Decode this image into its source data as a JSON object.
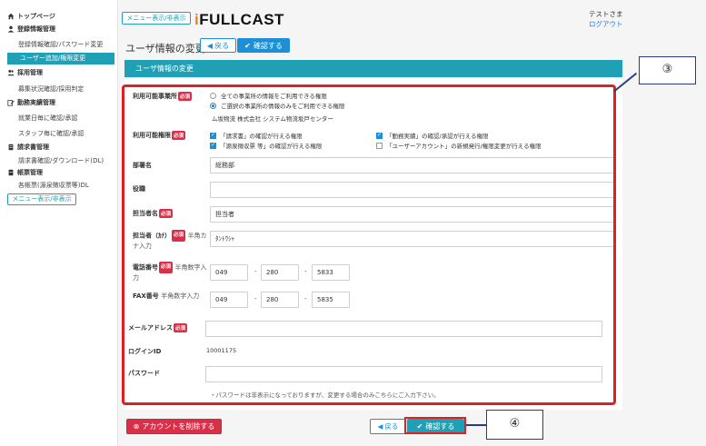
{
  "sidebar": {
    "top_page": "トップページ",
    "cat_registration": "登録情報管理",
    "item_password": "登録情報確認/パスワード変更",
    "item_user_add": "ユーザー追加/権限変更",
    "cat_recruit": "採用管理",
    "item_recruit_status": "募集状況確認/採用判定",
    "cat_attendance": "勤務実績管理",
    "item_daily": "就業日毎に確認/承認",
    "item_staff": "スタッフ毎に確認/承認",
    "cat_invoice": "請求書管理",
    "item_invoice_dl": "請求書確認/ダウンロード(DL)",
    "cat_forms": "帳票管理",
    "item_forms_dl": "各帳票(源泉徴収票等)DL",
    "menu_toggle": "メニュー表示/非表示"
  },
  "header": {
    "menu_toggle": "メニュー表示/非表示",
    "logo": "FULLCAST",
    "user_name": "テストさま",
    "logout": "ログアウト"
  },
  "page": {
    "title": "ユーザ情報の変更",
    "back": "戻る",
    "confirm": "確認する",
    "panel_title": "ユーザ情報の変更"
  },
  "form": {
    "required": "必須",
    "office_label": "利用可能事業所",
    "office_opt_all": "全ての事業所の情報をご利用できる権限",
    "office_opt_selected": "ご選択の事業所の情報のみをご利用できる権限",
    "office_name": "ム坂物流 株式会社 システム物流坂戸センター",
    "perm_label": "利用可能権限",
    "perm_invoice": "「請求書」の確認が行える権限",
    "perm_attendance": "「勤務実績」の確認/承認が行える権限",
    "perm_withholding": "「源泉徴収票 等」の確認が行える権限",
    "perm_user_account": "「ユーザーアカウント」の新規発行/権限変更が行える権限",
    "dept_label": "部署名",
    "dept_value": "総務部",
    "role_label": "役職",
    "role_value": "",
    "person_label": "担当者名",
    "person_value": "担当者",
    "kana_label": "担当者（ｶﾅ）",
    "kana_note": "半角カナ入力",
    "kana_value": "ﾀﾝﾄｳｼｬ",
    "phone_label": "電話番号",
    "phone_note": "半角数字入力",
    "phone_1": "049",
    "phone_2": "280",
    "phone_3": "5833",
    "fax_label": "FAX番号",
    "fax_note": "半角数字入力",
    "fax_1": "049",
    "fax_2": "280",
    "fax_3": "5835",
    "dash": "-",
    "email_label": "メールアドレス",
    "email_value": "",
    "login_label": "ログインID",
    "login_value": "10001175",
    "password_label": "パスワード",
    "password_value": "",
    "password_note": "・パスワードは非表示になっておりますが、変更する場合のみこちらにご入力下さい。"
  },
  "footer": {
    "delete": "アカウントを削除する",
    "back": "戻る",
    "confirm": "確認する"
  },
  "callouts": {
    "c3": "③",
    "c4": "④"
  },
  "colors": {
    "teal": "#20a0b4",
    "blue": "#1c8fd6",
    "red": "#d9304a",
    "highlight": "#e02020"
  }
}
